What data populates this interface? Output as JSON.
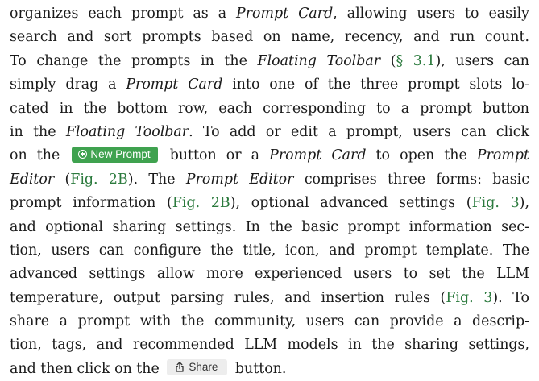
{
  "paragraph": {
    "lines": [
      [
        {
          "t": "organizes each prompt as a "
        },
        {
          "t": "Prompt Card",
          "s": "em"
        },
        {
          "t": ", allowing users to easily"
        }
      ],
      [
        {
          "t": "search and sort prompts based on name, recency, and run count."
        }
      ],
      [
        {
          "t": "To change the prompts in the "
        },
        {
          "t": "Floating Toolbar",
          "s": "em"
        },
        {
          "t": " ("
        },
        {
          "t": "§ 3.1",
          "s": "ref"
        },
        {
          "t": "), users can"
        }
      ],
      [
        {
          "t": "simply drag a "
        },
        {
          "t": "Prompt Card",
          "s": "em"
        },
        {
          "t": " into one of the three prompt slots lo-"
        }
      ],
      [
        {
          "t": "cated in the bottom row, each corresponding to a prompt button"
        }
      ],
      [
        {
          "t": "in the "
        },
        {
          "t": "Floating Toolbar",
          "s": "em"
        },
        {
          "t": ". To add or edit a prompt, users can click"
        }
      ],
      [
        {
          "t": "on the "
        },
        {
          "t": "New Prompt",
          "s": "btn-new"
        },
        {
          "t": " button or a "
        },
        {
          "t": "Prompt Card",
          "s": "em"
        },
        {
          "t": " to open the "
        },
        {
          "t": "Prompt",
          "s": "em"
        }
      ],
      [
        {
          "t": "Editor",
          "s": "em"
        },
        {
          "t": " ("
        },
        {
          "t": "Fig. 2B",
          "s": "ref"
        },
        {
          "t": "). The "
        },
        {
          "t": "Prompt Editor",
          "s": "em"
        },
        {
          "t": " comprises three forms: basic"
        }
      ],
      [
        {
          "t": "prompt information ("
        },
        {
          "t": "Fig. 2B",
          "s": "ref"
        },
        {
          "t": "), optional advanced settings ("
        },
        {
          "t": "Fig. 3",
          "s": "ref"
        },
        {
          "t": "),"
        }
      ],
      [
        {
          "t": "and optional sharing settings. In the basic prompt information sec-"
        }
      ],
      [
        {
          "t": "tion, users can configure the title, icon, and prompt template. The"
        }
      ],
      [
        {
          "t": "advanced settings allow more experienced users to set the LLM"
        }
      ],
      [
        {
          "t": "temperature, output parsing rules, and insertion rules ("
        },
        {
          "t": "Fig. 3",
          "s": "ref"
        },
        {
          "t": "). To"
        }
      ],
      [
        {
          "t": "share a prompt with the community, users can provide a descrip-"
        }
      ],
      [
        {
          "t": "tion, tags, and recommended LLM models in the sharing settings,"
        }
      ],
      [
        {
          "t": "and then click on the "
        },
        {
          "t": "Share",
          "s": "btn-share"
        },
        {
          "t": " button."
        }
      ]
    ]
  },
  "colors": {
    "reference_link": "#2b7a3d",
    "new_prompt_button_bg": "#3fa24f",
    "share_button_bg": "#ededed"
  },
  "icons": {
    "new_prompt_button": "plus-circle-icon",
    "share_button": "share-icon"
  }
}
